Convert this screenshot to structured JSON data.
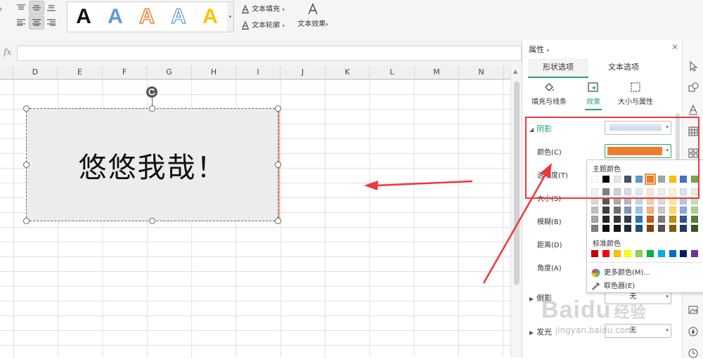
{
  "ribbon": {
    "style_letters": [
      "A",
      "A",
      "A",
      "A",
      "A"
    ],
    "text_fill": "文本填充",
    "text_outline": "文本轮廓",
    "text_effect": "文本效果"
  },
  "formula_bar": {
    "fx": "fx",
    "value": ""
  },
  "sheet": {
    "columns": [
      "D",
      "E",
      "F",
      "G",
      "H",
      "I",
      "J",
      "K",
      "L",
      "M",
      "N"
    ],
    "shape_text": "悠悠我哉！"
  },
  "panel": {
    "title": "属性",
    "tabs": [
      "形状选项",
      "文本选项"
    ],
    "subtabs": [
      "填充与线条",
      "效果",
      "大小与属性"
    ],
    "shadow_section": "阴影",
    "labels": {
      "color": "颜色(C)",
      "transparency": "透明度(T)",
      "size": "大小(S)",
      "blur": "模糊(B)",
      "distance": "距离(D)",
      "angle": "角度(A)"
    },
    "reflection_section": "倒影",
    "reflection_value": "无",
    "glow_section": "发光",
    "glow_value": "无"
  },
  "color_popup": {
    "theme_heading": "主题颜色",
    "standard_heading": "标准颜色",
    "more_colors": "更多颜色(M)...",
    "picker": "取色器(E)",
    "theme_row": [
      "#ffffff",
      "#000000",
      "#e7e6e6",
      "#44546a",
      "#5b9bd5",
      "#ed7d31",
      "#a5a5a5",
      "#ffc000",
      "#4472c4",
      "#70ad47"
    ],
    "shade_cols": [
      [
        "#f2f2f2",
        "#d9d9d9",
        "#bfbfbf",
        "#a6a6a6",
        "#808080"
      ],
      [
        "#808080",
        "#595959",
        "#404040",
        "#262626",
        "#0d0d0d"
      ],
      [
        "#d0cece",
        "#aeaaaa",
        "#757171",
        "#3a3838",
        "#171616"
      ],
      [
        "#d6dce4",
        "#adb9ca",
        "#8497b0",
        "#333f4f",
        "#222a35"
      ],
      [
        "#deebf6",
        "#bdd7ee",
        "#9dc3e6",
        "#2e75b5",
        "#1f4e79"
      ],
      [
        "#fbe5d5",
        "#f8cbad",
        "#f4b183",
        "#c55a11",
        "#843c0b"
      ],
      [
        "#ededed",
        "#dbdbdb",
        "#c9c9c9",
        "#7b7b7b",
        "#525252"
      ],
      [
        "#fff2cc",
        "#ffe699",
        "#ffd966",
        "#bf9000",
        "#7f6000"
      ],
      [
        "#dae3f3",
        "#b4c7e7",
        "#8faadc",
        "#2f5597",
        "#203864"
      ],
      [
        "#e2efd9",
        "#c5e0b3",
        "#a8d08d",
        "#538135",
        "#375623"
      ]
    ],
    "standard_row": [
      "#c00000",
      "#ff0000",
      "#ffc000",
      "#ffff00",
      "#92d050",
      "#00b050",
      "#00b0f0",
      "#0070c0",
      "#002060",
      "#7030a0"
    ],
    "current_color": "#ed7d31"
  },
  "watermark": {
    "brand": "Baidu",
    "sub": "jingyan.baidu.com",
    "cn": "经验"
  }
}
